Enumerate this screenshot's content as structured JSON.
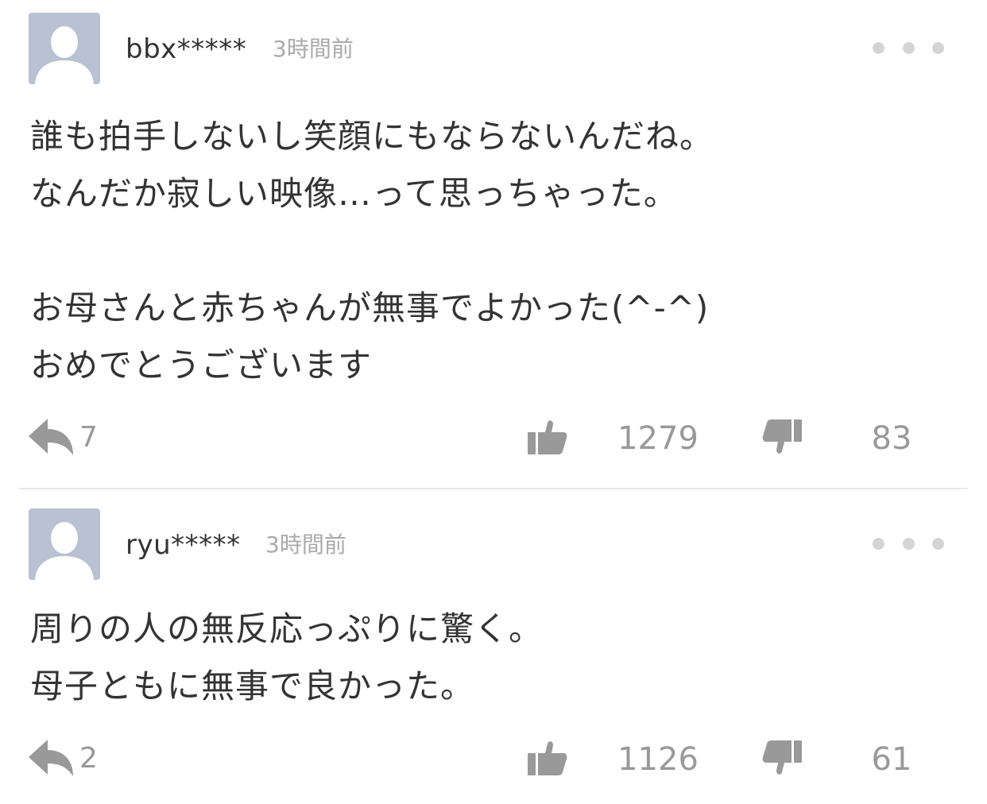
{
  "comments": [
    {
      "username": "bbx*****",
      "timestamp": "3時間前",
      "body": "誰も拍手しないし笑顔にもならないんだね。\nなんだか寂しい映像…って思っちゃった。\n\nお母さんと赤ちゃんが無事でよかった(^-^)\nおめでとうございます",
      "reply_count": "7",
      "like_count": "1279",
      "dislike_count": "83"
    },
    {
      "username": "ryu*****",
      "timestamp": "3時間前",
      "body": "周りの人の無反応っぷりに驚く。\n母子ともに無事で良かった。",
      "reply_count": "2",
      "like_count": "1126",
      "dislike_count": "61"
    }
  ],
  "icons": {
    "avatar": "default-user-avatar",
    "more": "more-dots-icon",
    "reply": "reply-arrow-icon",
    "like": "thumbs-up-icon",
    "dislike": "thumbs-down-icon"
  },
  "colors": {
    "avatar_bg": "#b8c2d2",
    "icon_gray": "#999999",
    "text": "#333333",
    "meta": "#aaaaaa",
    "divider": "#e8e8e8"
  }
}
